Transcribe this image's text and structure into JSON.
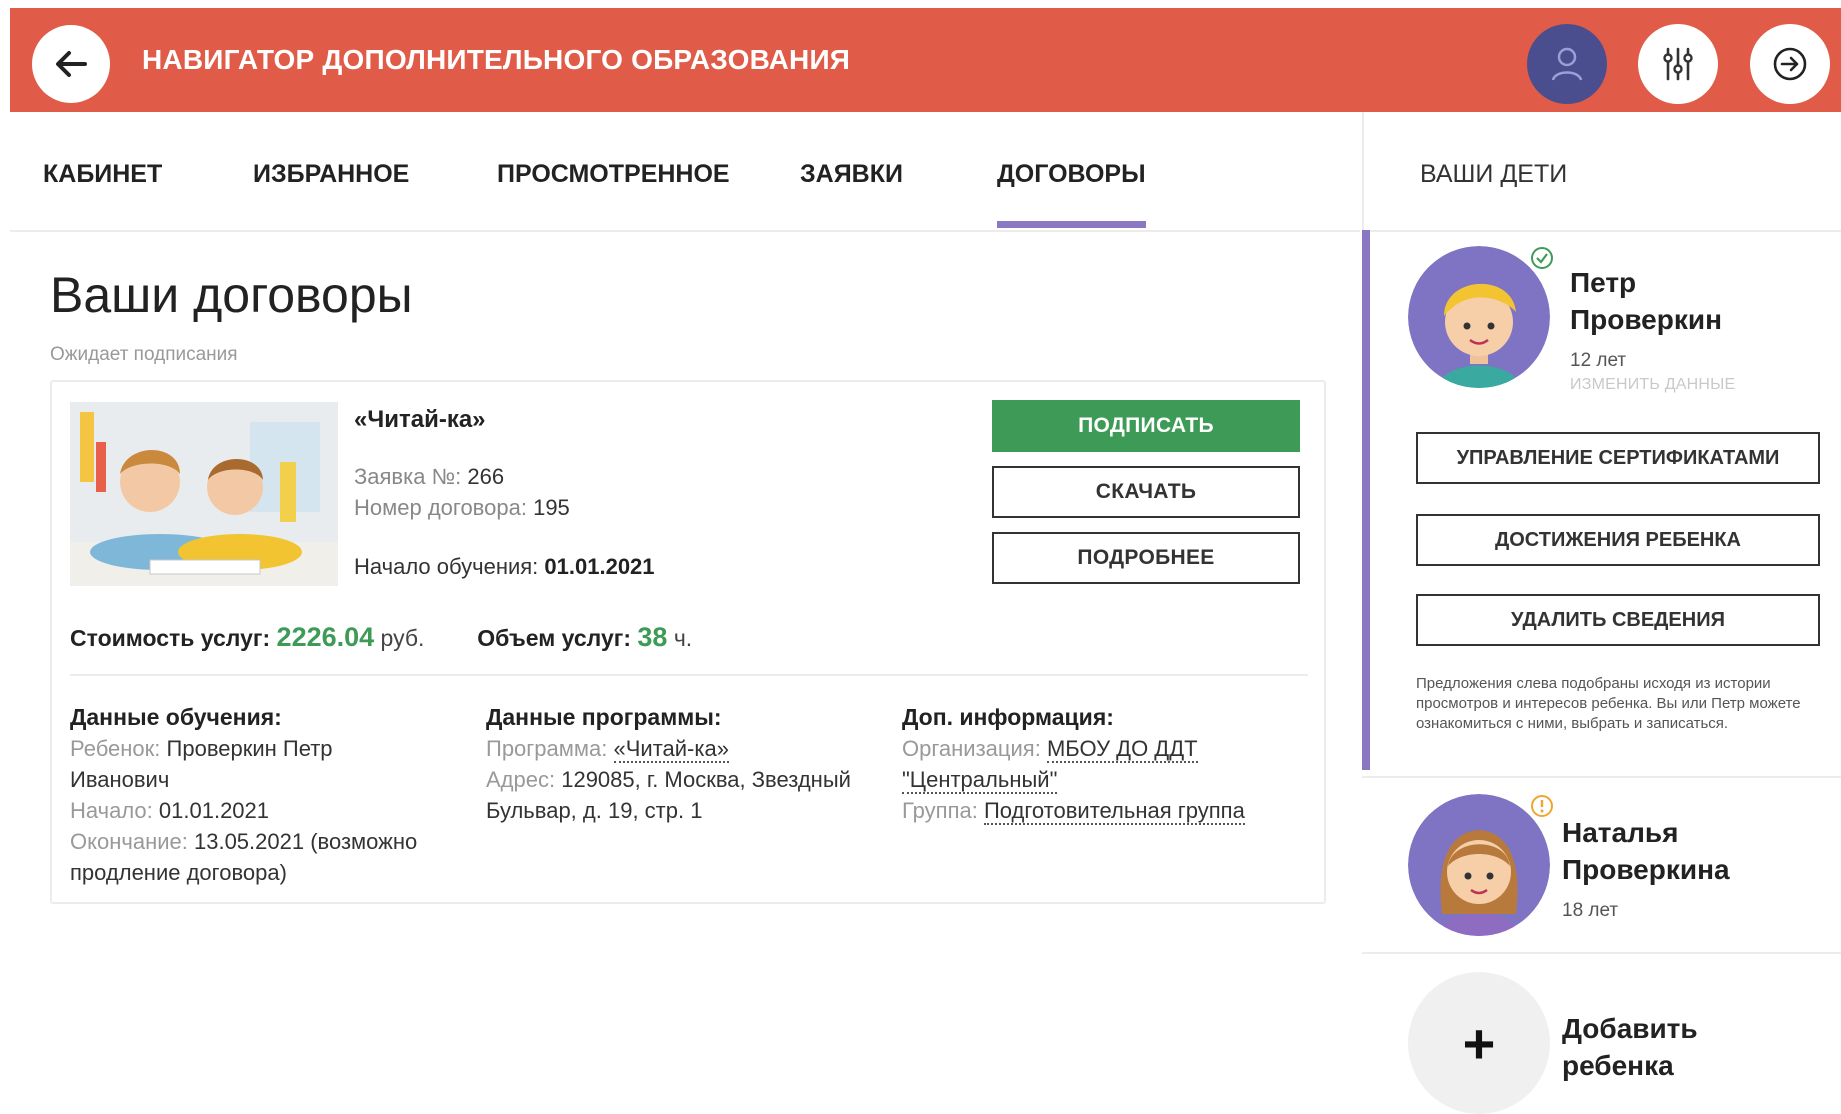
{
  "header": {
    "title": "НАВИГАТОР ДОПОЛНИТЕЛЬНОГО ОБРАЗОВАНИЯ",
    "icons": [
      "arrow-left-icon",
      "user-icon",
      "sliders-icon",
      "circle-arrow-right-icon"
    ],
    "colors": {
      "header_bg": "#e05b48",
      "profile_bg": "#4b4e8e",
      "accent": "#8a78c2",
      "primary_green": "#3e9b57"
    }
  },
  "tabs": [
    {
      "label": "КАБИНЕТ"
    },
    {
      "label": "ИЗБРАННОЕ"
    },
    {
      "label": "ПРОСМОТРЕННОЕ"
    },
    {
      "label": "ЗАЯВКИ"
    },
    {
      "label": "ДОГОВОРЫ",
      "active": true
    }
  ],
  "sidebar_header": "ВАШИ ДЕТИ",
  "main": {
    "page_title": "Ваши договоры",
    "status_label": "Ожидает подписания",
    "contract": {
      "title": "«Читай-ка»",
      "application_label": "Заявка №:",
      "application_number": "266",
      "contract_label": "Номер договора:",
      "contract_number": "195",
      "start_label": "Начало обучения:",
      "start_date": "01.01.2021",
      "buttons": {
        "sign": "ПОДПИСАТЬ",
        "download": "СКАЧАТЬ",
        "details": "ПОДРОБНЕЕ"
      },
      "cost_label": "Стоимость услуг:",
      "cost_value": "2226.04",
      "cost_unit": "руб.",
      "volume_label": "Объем услуг:",
      "volume_value": "38",
      "volume_unit": "ч.",
      "education": {
        "heading": "Данные обучения:",
        "child_label": "Ребенок:",
        "child_value_1": "Проверкин Петр",
        "child_value_2": "Иванович",
        "start_label": "Начало:",
        "start_value": "01.01.2021",
        "end_label": "Окончание:",
        "end_value_1": "13.05.2021 (возможно",
        "end_value_2": "продление договора)"
      },
      "program": {
        "heading": "Данные программы:",
        "program_label": "Программа:",
        "program_value": "«Читай-ка»",
        "address_label": "Адрес:",
        "address_value_1": "129085, г. Москва, Звездный",
        "address_value_2": "Бульвар, д. 19, стр. 1"
      },
      "extra": {
        "heading": "Доп. информация:",
        "org_label": "Организация:",
        "org_value_1": "МБОУ ДО ДДТ",
        "org_value_2": "\"Центральный\"",
        "group_label": "Группа:",
        "group_value": "Подготовительная группа"
      }
    }
  },
  "children": [
    {
      "first_name": "Петр",
      "last_name": "Проверкин",
      "age": "12 лет",
      "edit_link": "ИЗМЕНИТЬ ДАННЫЕ",
      "badge_icon": "check-circle-icon",
      "buttons": [
        "УПРАВЛЕНИЕ СЕРТИФИКАТАМИ",
        "ДОСТИЖЕНИЯ РЕБЕНКА",
        "УДАЛИТЬ СВЕДЕНИЯ"
      ],
      "hint": "Предложения слева подобраны исходя из истории просмотров и интересов ребенка. Вы или Петр можете ознакомиться с ними, выбрать и записаться."
    },
    {
      "first_name": "Наталья",
      "last_name": "Проверкина",
      "age": "18 лет",
      "badge_icon": "exclamation-circle-icon"
    }
  ],
  "add_child": {
    "line1": "Добавить",
    "line2": "ребенка",
    "icon": "plus-icon"
  }
}
